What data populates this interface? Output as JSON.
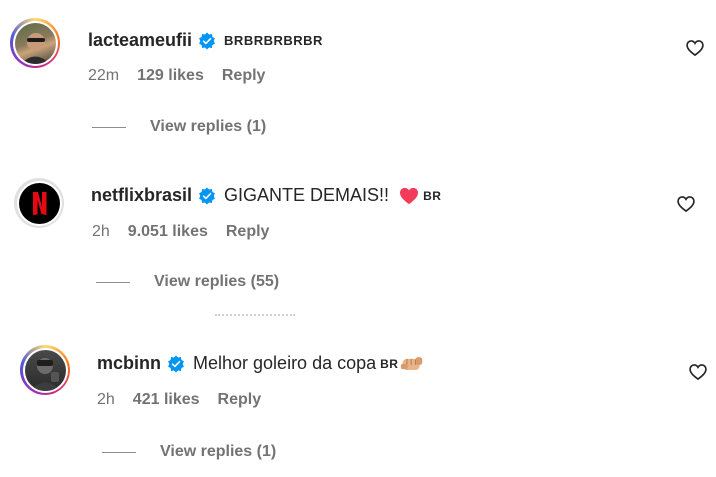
{
  "comments": [
    {
      "username": "lacteameufii",
      "text": "",
      "flag": "BRBRBRBRBR",
      "time": "22m",
      "likes": "129 likes",
      "reply": "Reply",
      "view_replies": "View replies (1)"
    },
    {
      "username": "netflixbrasil",
      "text": "GIGANTE DEMAIS!!",
      "flag": "BR",
      "time": "2h",
      "likes": "9.051 likes",
      "reply": "Reply",
      "view_replies": "View replies (55)"
    },
    {
      "username": "mcbinn",
      "text": "Melhor goleiro da copa",
      "flag": "BR",
      "time": "2h",
      "likes": "421 likes",
      "reply": "Reply",
      "view_replies": "View replies (1)"
    }
  ],
  "colors": {
    "verified_blue": "#0095f6",
    "netflix_red": "#e50914",
    "muted_text": "#737373",
    "heart_red": "#f23b5a"
  },
  "icons": [
    "verified-badge-icon",
    "heart-outline-icon",
    "red-heart-emoji",
    "fist-emoji",
    "netflix-logo-icon"
  ]
}
